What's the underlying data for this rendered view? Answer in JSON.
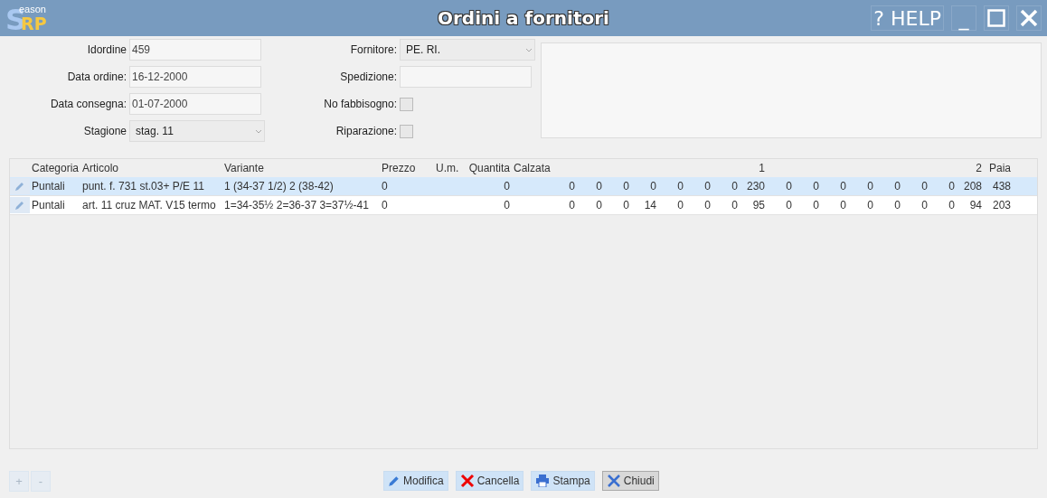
{
  "window": {
    "logo": {
      "initial": "S",
      "rest": "eason",
      "suffix": "RP"
    },
    "title": "Ordini a fornitori",
    "controls": [
      {
        "kind": "help",
        "label": "? HELP"
      },
      {
        "kind": "minimize",
        "label": "_"
      },
      {
        "kind": "maximize"
      },
      {
        "kind": "close"
      }
    ]
  },
  "form": {
    "left": [
      {
        "label": "Idordine",
        "kind": "text",
        "value": "459"
      },
      {
        "label": "Data ordine:",
        "kind": "text",
        "value": "16-12-2000"
      },
      {
        "label": "Data consegna:",
        "kind": "text",
        "value": "01-07-2000"
      },
      {
        "label": "Stagione",
        "kind": "select",
        "value": "stag. 11"
      }
    ],
    "middle": [
      {
        "label": "Fornitore:",
        "kind": "select",
        "value": "PE. RI."
      },
      {
        "label": "Spedizione:",
        "kind": "text"
      },
      {
        "label": "No fabbisogno:",
        "kind": "checkbox",
        "checked": false
      },
      {
        "label": "Riparazione:",
        "kind": "checkbox",
        "checked": false
      }
    ]
  },
  "table": {
    "columns": [
      "Categoria",
      "Articolo",
      "Variante",
      "Prezzo",
      "U.m.",
      "Quantita",
      "Calzata"
    ],
    "group_headers": [
      "1",
      "2"
    ],
    "total_header": "Paia",
    "rows": [
      {
        "selected": true,
        "cells": [
          "Puntali",
          "punt. f. 731 st.03+ P/E 11",
          "1 (34-37 1/2)   2 (38-42)",
          "0",
          "0"
        ],
        "sizes": [
          "0",
          "0",
          "0",
          "0",
          "0",
          "0",
          "0",
          "230",
          "0",
          "0",
          "0",
          "0",
          "0",
          "0",
          "0",
          "208"
        ],
        "total": "438"
      },
      {
        "selected": false,
        "cells": [
          "Puntali",
          "art. 11 cruz  MAT. V15 termo",
          "1=34-35½  2=36-37 3=37½-41",
          "0",
          "0"
        ],
        "sizes": [
          "0",
          "0",
          "0",
          "14",
          "0",
          "0",
          "0",
          "95",
          "0",
          "0",
          "0",
          "0",
          "0",
          "0",
          "0",
          "94"
        ],
        "total": "203"
      }
    ]
  },
  "row_buttons": [
    {
      "label": "+",
      "disabled": true
    },
    {
      "label": "-",
      "disabled": true
    }
  ],
  "actions": [
    {
      "kind": "edit",
      "label": "Modifica"
    },
    {
      "kind": "delete",
      "label": "Cancella"
    },
    {
      "kind": "print",
      "label": "Stampa"
    },
    {
      "kind": "close",
      "label": "Chiudi"
    }
  ]
}
